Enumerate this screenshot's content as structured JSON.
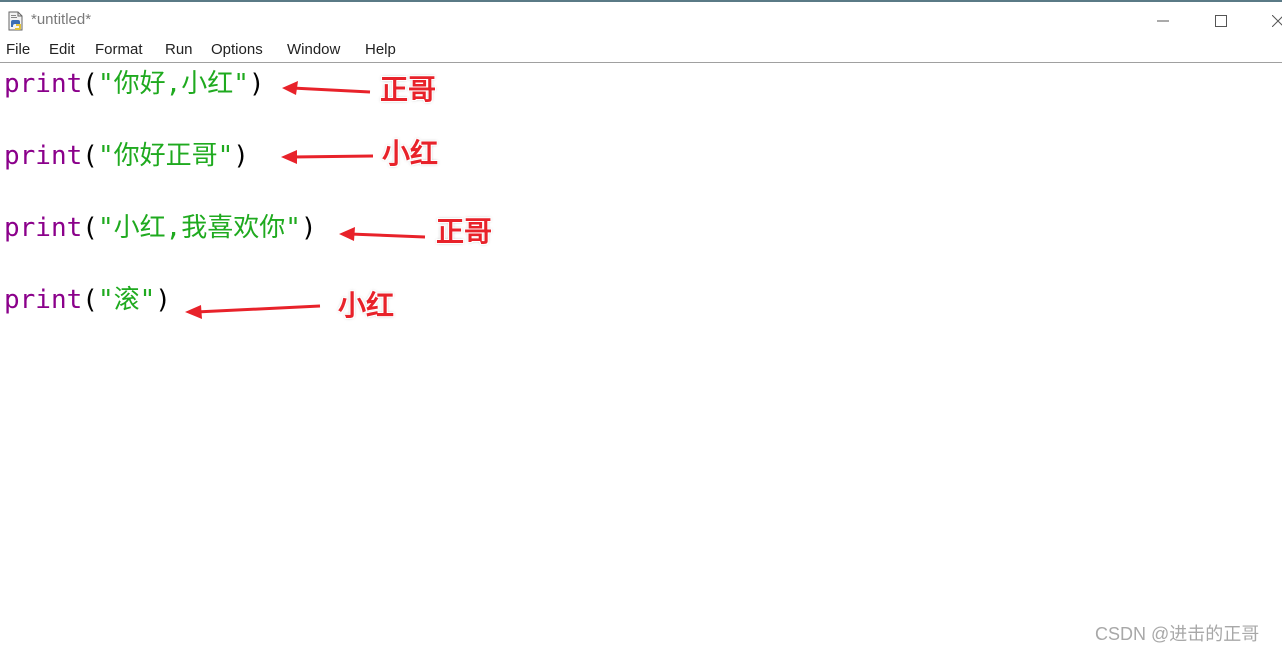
{
  "window": {
    "title": "*untitled*",
    "controls": {
      "minimize": "—",
      "maximize": "☐",
      "close": "✕"
    }
  },
  "menu": [
    "File",
    "Edit",
    "Format",
    "Run",
    "Options",
    "Window",
    "Help"
  ],
  "code": [
    {
      "keyword": "print",
      "open": "(",
      "string": "\"你好,小红\"",
      "close": ")"
    },
    {
      "keyword": "print",
      "open": "(",
      "string": "\"你好正哥\"",
      "close": ")"
    },
    {
      "keyword": "print",
      "open": "(",
      "string": "\"小红,我喜欢你\"",
      "close": ")"
    },
    {
      "keyword": "print",
      "open": "(",
      "string": "\"滚\"",
      "close": ")"
    }
  ],
  "annotations": [
    "正哥",
    "小红",
    "正哥",
    "小红"
  ],
  "colors": {
    "keyword": "#8b008b",
    "string": "#1faa1f",
    "annotation": "#e8222a"
  },
  "watermark": "CSDN @进击的正哥"
}
